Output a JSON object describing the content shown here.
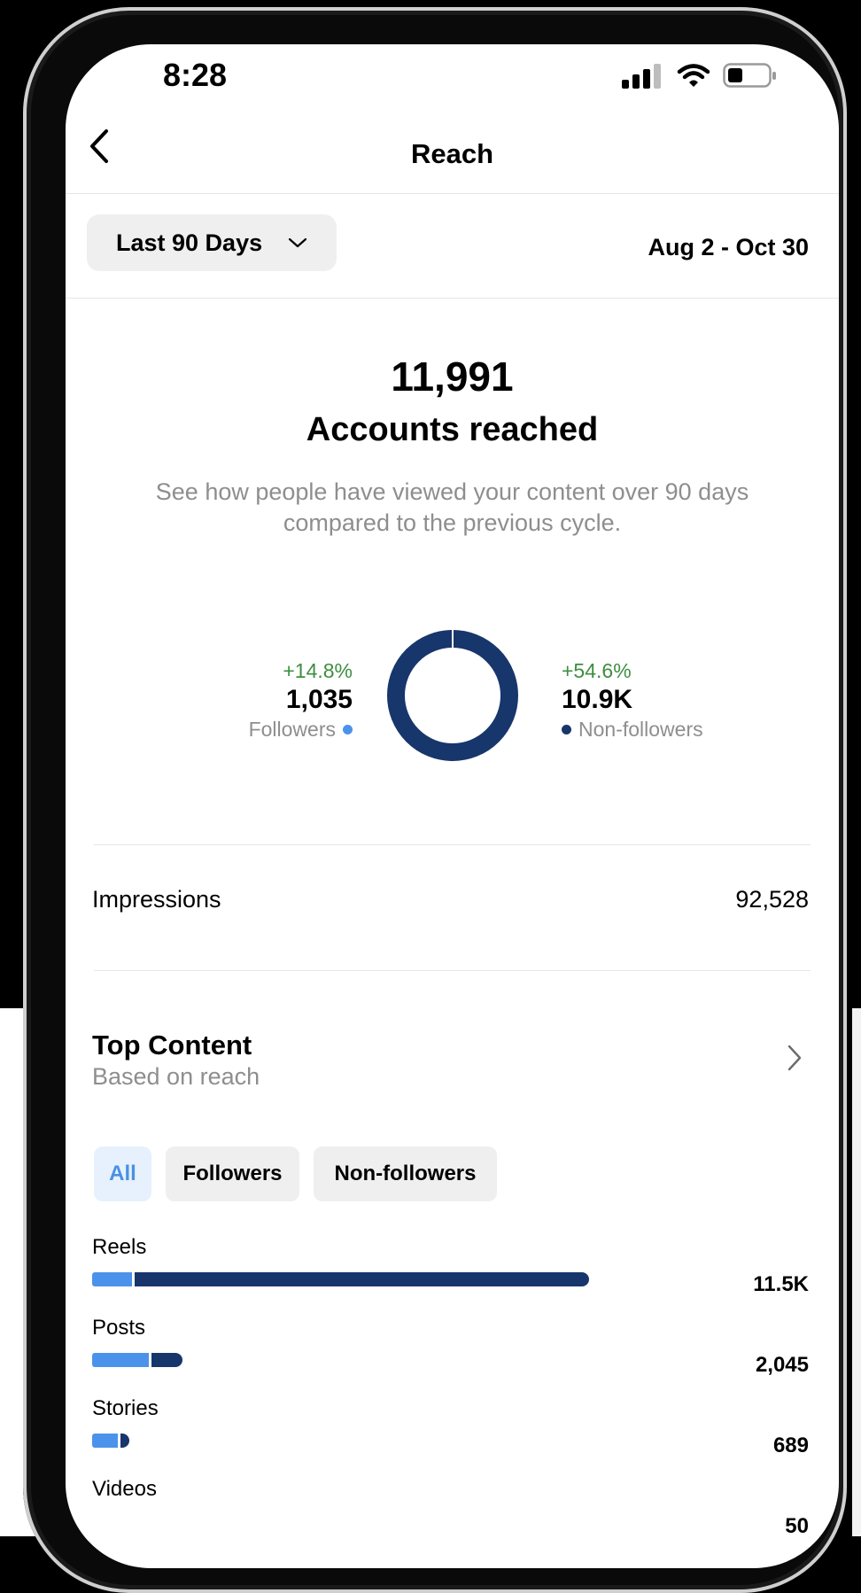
{
  "status_bar": {
    "time": "8:28"
  },
  "header": {
    "title": "Reach"
  },
  "filter": {
    "range_label": "Last 90 Days",
    "date_range": "Aug 2 - Oct 30"
  },
  "summary": {
    "accounts_reached_value": "11,991",
    "accounts_reached_label": "Accounts reached",
    "description": "See how people have viewed your content over 90 days compared to the previous cycle."
  },
  "breakdown": {
    "followers": {
      "change": "+14.8%",
      "value": "1,035",
      "label": "Followers",
      "color": "#4b93ea"
    },
    "non_followers": {
      "change": "+54.6%",
      "value": "10.9K",
      "label": "Non-followers",
      "color": "#17366b"
    }
  },
  "impressions": {
    "label": "Impressions",
    "value": "92,528"
  },
  "top_content": {
    "title": "Top Content",
    "subtitle": "Based on reach",
    "chips": [
      "All",
      "Followers",
      "Non-followers"
    ],
    "active_chip": "All",
    "rows": [
      {
        "label": "Reels",
        "value": "11.5K",
        "followers_share": 0.08,
        "total_fraction": 1.0
      },
      {
        "label": "Posts",
        "value": "2,045",
        "followers_share": 0.65,
        "total_fraction": 0.178
      },
      {
        "label": "Stories",
        "value": "689",
        "followers_share": 0.75,
        "total_fraction": 0.07
      },
      {
        "label": "Videos",
        "value": "50",
        "followers_share": 0,
        "total_fraction": 0
      }
    ]
  },
  "colors": {
    "followers": "#4b93ea",
    "non_followers": "#17366b",
    "positive_change": "#3e8e41"
  }
}
